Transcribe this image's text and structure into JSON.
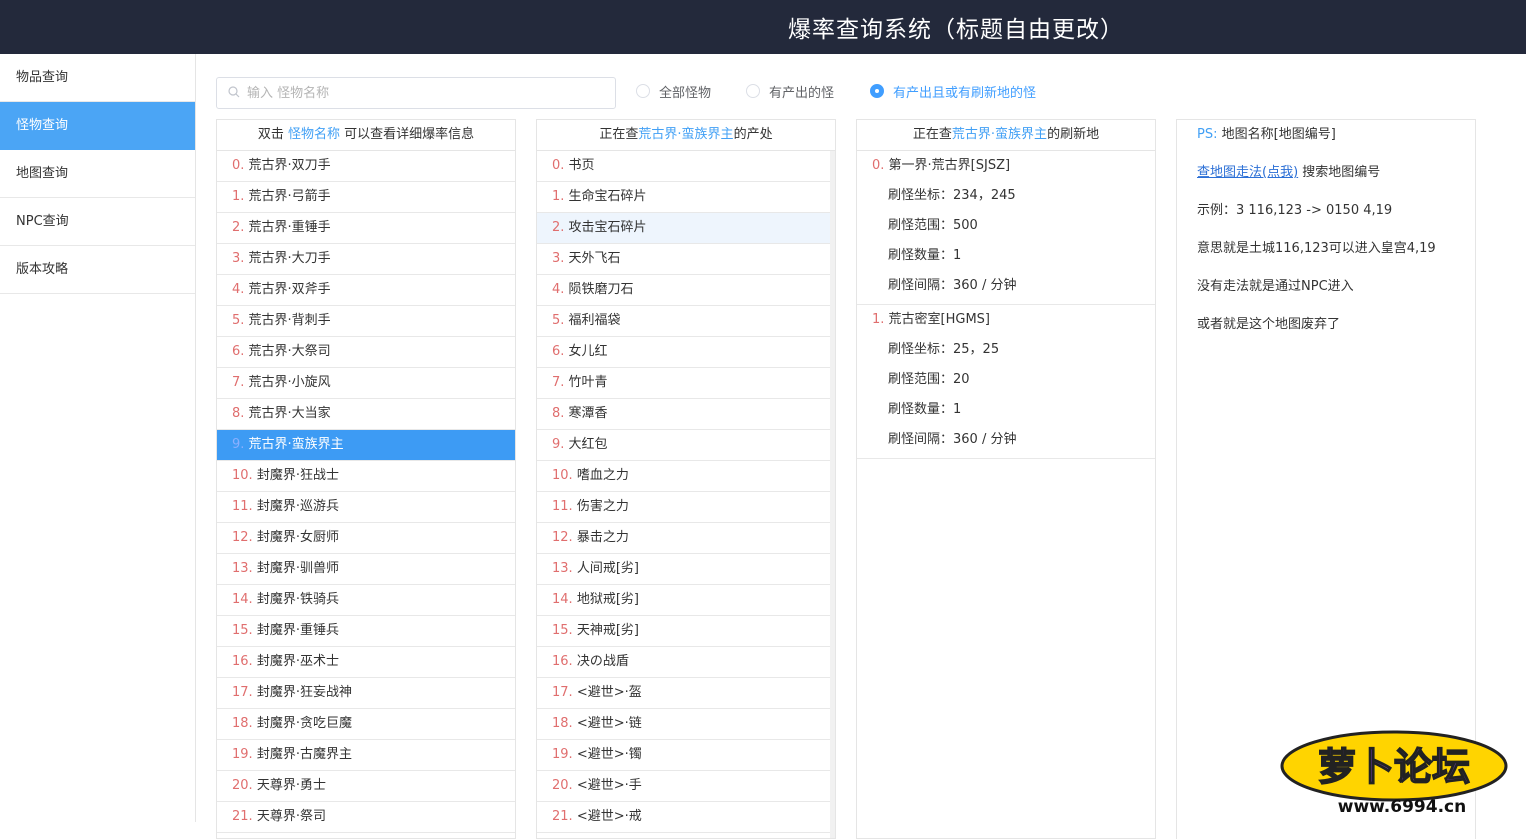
{
  "header": {
    "title": "爆率查询系统（标题自由更改）"
  },
  "sidebar": {
    "items": [
      {
        "label": "物品查询"
      },
      {
        "label": "怪物查询"
      },
      {
        "label": "地图查询"
      },
      {
        "label": "NPC查询"
      },
      {
        "label": "版本攻略"
      }
    ],
    "active_index": 1
  },
  "search": {
    "placeholder": "输入 怪物名称",
    "value": ""
  },
  "filters": {
    "options": [
      "全部怪物",
      "有产出的怪",
      "有产出且或有刷新地的怪"
    ],
    "selected_index": 2
  },
  "monster_list": {
    "header_prefix": "双击 ",
    "header_highlight": "怪物名称",
    "header_suffix": " 可以查看详细爆率信息",
    "selected_index": 9,
    "items": [
      "荒古界·双刀手",
      "荒古界·弓箭手",
      "荒古界·重锤手",
      "荒古界·大刀手",
      "荒古界·双斧手",
      "荒古界·背刺手",
      "荒古界·大祭司",
      "荒古界·小旋风",
      "荒古界·大当家",
      "荒古界·蛮族界主",
      "封魔界·狂战士",
      "封魔界·巡游兵",
      "封魔界·女厨师",
      "封魔界·驯兽师",
      "封魔界·铁骑兵",
      "封魔界·重锤兵",
      "封魔界·巫术士",
      "封魔界·狂妄战神",
      "封魔界·贪吃巨魔",
      "封魔界·古魔界主",
      "天尊界·勇士",
      "天尊界·祭司"
    ]
  },
  "drop_list": {
    "header_prefix": "正在查",
    "header_highlight": "荒古界·蛮族界主",
    "header_suffix": "的产处",
    "hover_index": 2,
    "items": [
      "书页",
      "生命宝石碎片",
      "攻击宝石碎片",
      "天外飞石",
      "陨铁磨刀石",
      "福利福袋",
      "女儿红",
      "竹叶青",
      "寒潭香",
      "大红包",
      "嗜血之力",
      "伤害之力",
      "暴击之力",
      "人间戒[劣]",
      "地狱戒[劣]",
      "天神戒[劣]",
      "决の战盾",
      "<避世>·盔",
      "<避世>·链",
      "<避世>·镯",
      "<避世>·手",
      "<避世>·戒"
    ]
  },
  "spawn_list": {
    "header_prefix": "正在查",
    "header_highlight": "荒古界·蛮族界主",
    "header_suffix": "的刷新地",
    "locations": [
      {
        "name": "第一界·荒古界[SJSZ]",
        "coord": "刷怪坐标：234，245",
        "range": "刷怪范围：500",
        "count": "刷怪数量：1",
        "interval": "刷怪间隔：360 / 分钟"
      },
      {
        "name": "荒古密室[HGMS]",
        "coord": "刷怪坐标：25，25",
        "range": "刷怪范围：20",
        "count": "刷怪数量：1",
        "interval": "刷怪间隔：360 / 分钟"
      }
    ]
  },
  "notes": {
    "ps_label": "PS:",
    "ps_text": " 地图名称[地图编号]",
    "link_text": "查地图走法(点我)",
    "link_suffix": " 搜索地图编号",
    "example": "示例：3 116,123 -> 0150 4,19",
    "meaning": "意思就是土城116,123可以进入皇宫4,19",
    "npc": "没有走法就是通过NPC进入",
    "abandoned": "或者就是这个地图废弃了"
  },
  "watermark": {
    "text": "萝卜论坛",
    "url": "www.6994.cn"
  },
  "colors": {
    "header_bg": "#23293b",
    "accent": "#3d9bf4",
    "highlight": "#42a0f5",
    "index": "#e06e6e"
  }
}
